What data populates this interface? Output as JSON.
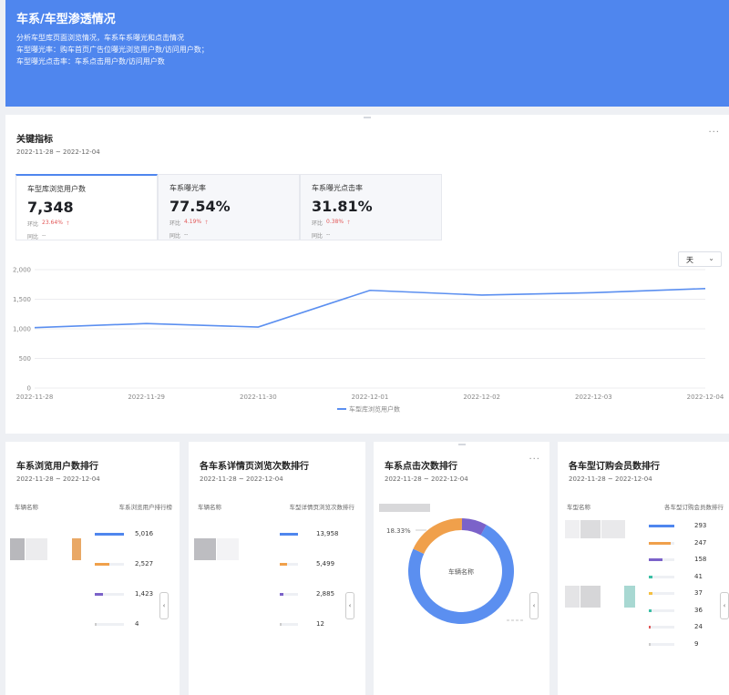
{
  "banner": {
    "title": "车系/车型渗透情况",
    "line1": "分析车型库页面浏览情况，车系车系曝光和点击情况",
    "line2": "车型曝光率：购车首页广告位曝光浏览用户数/访问用户数；",
    "line3": "车型曝光点击率：车系点击用户数/访问用户数"
  },
  "kpi_card": {
    "title": "关键指标",
    "date_range": "2022-11-28 ~ 2022-12-04",
    "more": "···",
    "kpis": [
      {
        "label": "车型库浏览用户数",
        "value": "7,348",
        "mom_label": "环比",
        "mom_value": "23.64%",
        "mom_arrow": "🡑",
        "yoy_label": "同比",
        "yoy_value": "--"
      },
      {
        "label": "车系曝光率",
        "value": "77.54%",
        "mom_label": "环比",
        "mom_value": "4.19%",
        "mom_arrow": "🡑",
        "yoy_label": "同比",
        "yoy_value": "--"
      },
      {
        "label": "车系曝光点击率",
        "value": "31.81%",
        "mom_label": "环比",
        "mom_value": "0.38%",
        "mom_arrow": "🡑",
        "yoy_label": "同比",
        "yoy_value": "--"
      }
    ],
    "granularity": "天",
    "granularity_chevron": "⌄"
  },
  "chart_data": {
    "type": "line",
    "x": [
      "2022-11-28",
      "2022-11-29",
      "2022-11-30",
      "2022-12-01",
      "2022-12-02",
      "2022-12-03",
      "2022-12-04"
    ],
    "series": [
      {
        "name": "车型库浏览用户数",
        "values": [
          1020,
          1090,
          1030,
          1650,
          1570,
          1610,
          1680
        ]
      }
    ],
    "yticks": [
      "2,000",
      "1,500",
      "1,000",
      "500",
      "0"
    ],
    "ylim": [
      0,
      2000
    ],
    "legend_position": "bottom",
    "color": "#5b8ff0"
  },
  "rank_cards": [
    {
      "title": "车系浏览用户数排行",
      "date_range": "2022-11-28 ~ 2022-12-04",
      "col1": "车辆名称",
      "col2": "车系浏览用户排行榜",
      "rows": [
        {
          "value": "5,016",
          "ratio": 1.0,
          "color": "#4f86ee"
        },
        {
          "value": "2,527",
          "ratio": 0.5,
          "color": "#f0a04b"
        },
        {
          "value": "1,423",
          "ratio": 0.28,
          "color": "#7b62c9"
        },
        {
          "value": "4",
          "ratio": 0.0,
          "color": "#cccccc"
        }
      ]
    },
    {
      "title": "各车系详情页浏览次数排行",
      "date_range": "2022-11-28 ~ 2022-12-04",
      "col1": "车辆名称",
      "col2": "车型详情页浏览次数排行",
      "rows": [
        {
          "value": "13,958",
          "ratio": 1.0,
          "color": "#4f86ee"
        },
        {
          "value": "5,499",
          "ratio": 0.39,
          "color": "#f0a04b"
        },
        {
          "value": "2,885",
          "ratio": 0.21,
          "color": "#7b62c9"
        },
        {
          "value": "12",
          "ratio": 0.0,
          "color": "#cccccc"
        }
      ]
    },
    {
      "title": "车系点击次数排行",
      "date_range": "2022-11-28 ~ 2022-12-04",
      "more": "···",
      "donut": {
        "center_label": "车辆名称",
        "slice_label": "18.33%",
        "small_label": "5",
        "slices": [
          {
            "value": 74,
            "color": "#5b8ff0"
          },
          {
            "value": 18.33,
            "color": "#f0a04b"
          },
          {
            "value": 7.67,
            "color": "#7b62c9"
          }
        ]
      }
    },
    {
      "title": "各车型订购会员数排行",
      "date_range": "2022-11-28 ~ 2022-12-04",
      "col1": "车型名称",
      "col2": "各车型订购会员数排行",
      "rows": [
        {
          "value": "293",
          "ratio": 1.0,
          "color": "#4f86ee"
        },
        {
          "value": "247",
          "ratio": 0.84,
          "color": "#f0a04b"
        },
        {
          "value": "158",
          "ratio": 0.54,
          "color": "#7b62c9"
        },
        {
          "value": "41",
          "ratio": 0.14,
          "color": "#3bbfa5"
        },
        {
          "value": "37",
          "ratio": 0.13,
          "color": "#f5c042"
        },
        {
          "value": "36",
          "ratio": 0.12,
          "color": "#3bbfa5"
        },
        {
          "value": "24",
          "ratio": 0.08,
          "color": "#e25757"
        },
        {
          "value": "9",
          "ratio": 0.03,
          "color": "#cccccc"
        }
      ]
    }
  ],
  "scroll_glyph": "‹"
}
